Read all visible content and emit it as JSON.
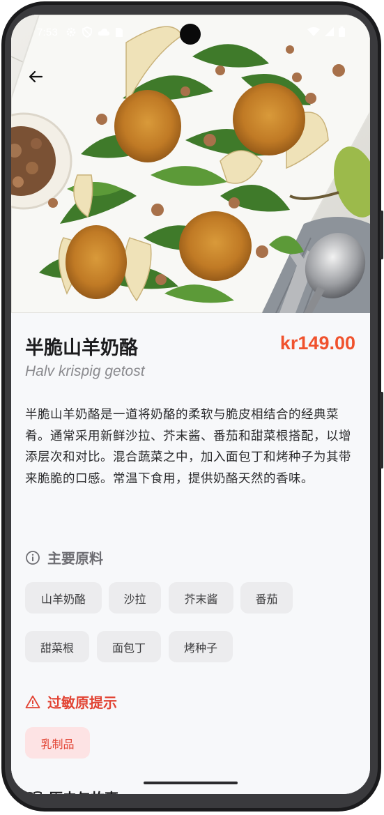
{
  "status_bar": {
    "time": "7:53",
    "left_icons": [
      "gear-icon",
      "shield-icon",
      "cloud-icon",
      "sim-icon"
    ],
    "right_icons": [
      "wifi-icon",
      "signal-icon",
      "battery-icon"
    ]
  },
  "hero": {
    "image_subject": "fried goat cheese salad with pears, arugula and walnuts"
  },
  "product": {
    "title": "半脆山羊奶酪",
    "price": "kr149.00",
    "subtitle": "Halv krispig getost",
    "description": "半脆山羊奶酪是一道将奶酪的柔软与脆皮相结合的经典菜肴。通常采用新鲜沙拉、芥末酱、番茄和甜菜根搭配，以增添层次和对比。混合蔬菜之中，加入面包丁和烤种子为其带来脆脆的口感。常温下食用，提供奶酪天然的香味。"
  },
  "ingredients": {
    "heading": "主要原料",
    "items": [
      "山羊奶酪",
      "沙拉",
      "芥末酱",
      "番茄",
      "甜菜根",
      "面包丁",
      "烤种子"
    ]
  },
  "allergens": {
    "heading": "过敏原提示",
    "items": [
      "乳制品"
    ]
  },
  "history": {
    "heading": "历史与故事"
  },
  "colors": {
    "price": "#f0522d",
    "allergen": "#e24434",
    "allergen_chip_bg": "#fde3e4",
    "chip_bg": "#ececee",
    "page_bg": "#f7f8fa"
  }
}
